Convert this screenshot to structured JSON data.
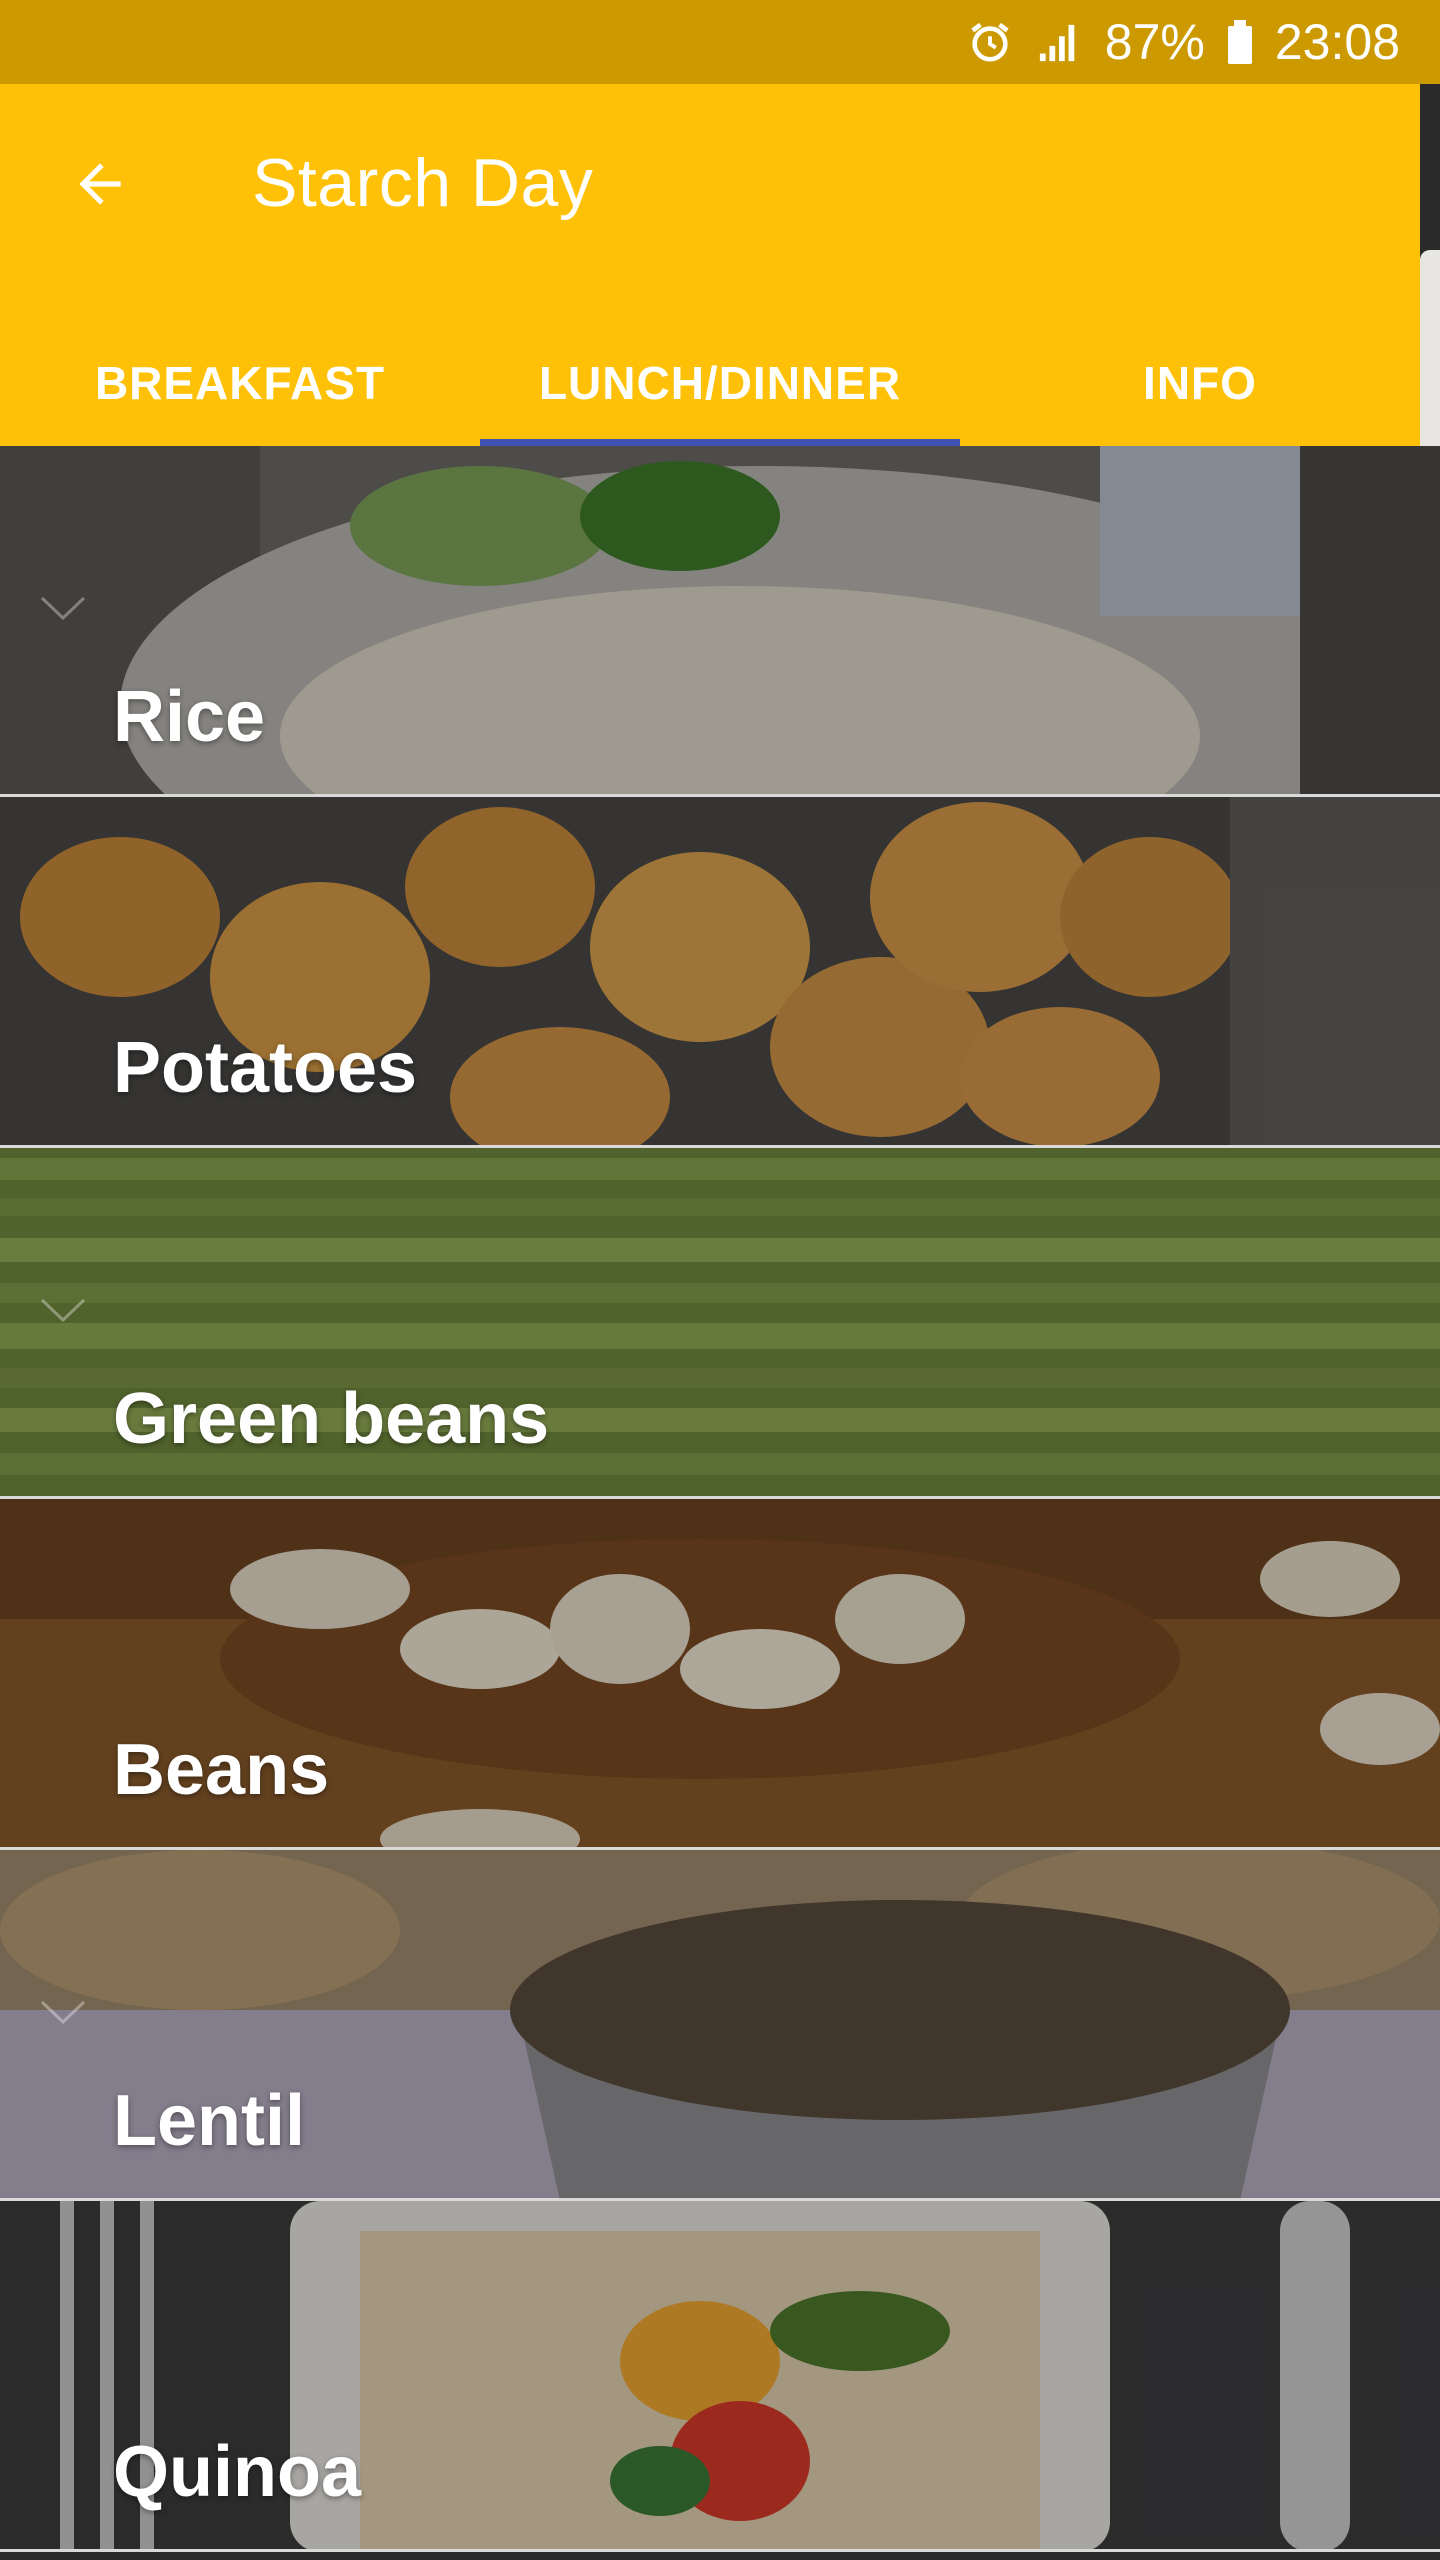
{
  "status_bar": {
    "battery": "87%",
    "time": "23:08",
    "icons": [
      "alarm-icon",
      "signal-icon",
      "battery-icon"
    ]
  },
  "app_bar": {
    "title": "Starch Day",
    "back_icon": "arrow-left-icon",
    "background_color": "#ffc107",
    "status_color": "#cc9a00"
  },
  "tabs": [
    {
      "label": "BREAKFAST",
      "selected": false
    },
    {
      "label": "LUNCH/DINNER",
      "selected": true
    },
    {
      "label": "INFO",
      "selected": false
    }
  ],
  "indicator_color": "#3f51b5",
  "items": [
    {
      "label": "Rice"
    },
    {
      "label": "Potatoes"
    },
    {
      "label": "Green beans"
    },
    {
      "label": "Beans"
    },
    {
      "label": "Lentil"
    },
    {
      "label": "Quinoa"
    }
  ]
}
